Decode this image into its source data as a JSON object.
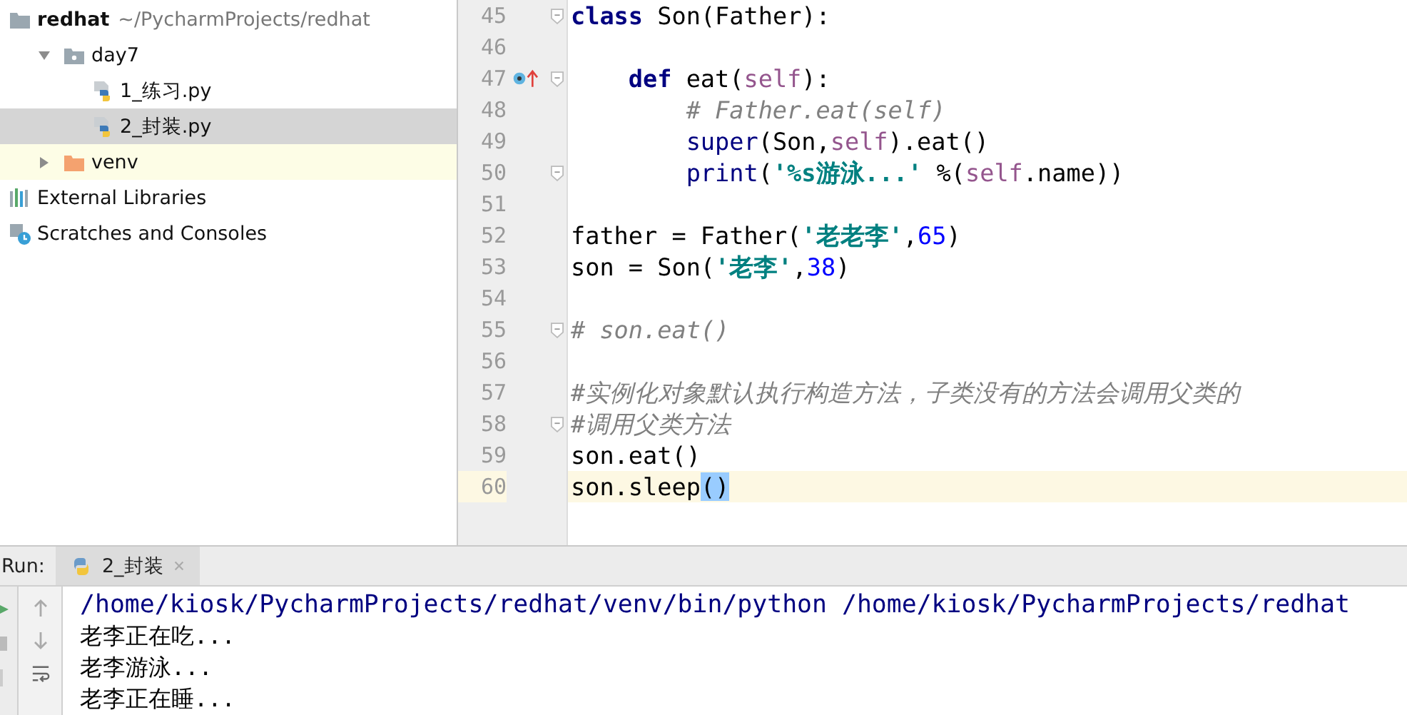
{
  "project_tree": {
    "items": [
      {
        "label": "redhat",
        "path": "~/PycharmProjects/redhat",
        "kind": "folder",
        "bold": true,
        "selected": false,
        "highlighted": false,
        "children": [
          {
            "label": "day7",
            "kind": "package",
            "expanded": true,
            "selected": false,
            "highlighted": false,
            "children": [
              {
                "label": "1_练习.py",
                "kind": "pyfile",
                "selected": false,
                "highlighted": false
              },
              {
                "label": "2_封装.py",
                "kind": "pyfile",
                "selected": true,
                "highlighted": false
              }
            ]
          },
          {
            "label": "venv",
            "kind": "venv",
            "expanded": false,
            "selected": false,
            "highlighted": true
          }
        ]
      },
      {
        "label": "External Libraries",
        "kind": "libraries",
        "selected": false,
        "highlighted": false
      },
      {
        "label": "Scratches and Consoles",
        "kind": "scratches",
        "selected": false,
        "highlighted": false
      }
    ]
  },
  "editor": {
    "lines": [
      {
        "number": "45",
        "fold": true,
        "current": false,
        "segments": [
          {
            "kind": "keyword",
            "text": "class"
          },
          {
            "kind": "plain",
            "text": " Son(Father):"
          }
        ],
        "children": [
          {
            "number": "46",
            "current": false
          },
          {
            "number": "47",
            "fold": true,
            "override": true,
            "current": false,
            "segments": [
              {
                "kind": "keyword",
                "text": "def"
              },
              {
                "kind": "plain",
                "text": " eat("
              },
              {
                "kind": "self",
                "text": "self"
              },
              {
                "kind": "plain",
                "text": "):"
              }
            ],
            "children": [
              {
                "number": "48",
                "current": false,
                "segments": [
                  {
                    "kind": "comment",
                    "text": "# Father.eat(self)"
                  }
                ]
              },
              {
                "number": "49",
                "current": false,
                "segments": [
                  {
                    "kind": "builtin",
                    "text": "super"
                  },
                  {
                    "kind": "plain",
                    "text": "(Son,"
                  },
                  {
                    "kind": "self",
                    "text": "self"
                  },
                  {
                    "kind": "plain",
                    "text": ").eat()"
                  }
                ]
              },
              {
                "number": "50",
                "fold": true,
                "current": false,
                "segments": [
                  {
                    "kind": "builtin",
                    "text": "print"
                  },
                  {
                    "kind": "plain",
                    "text": "("
                  },
                  {
                    "kind": "string",
                    "text": "'%s游泳...'"
                  },
                  {
                    "kind": "plain",
                    "text": " %("
                  },
                  {
                    "kind": "self",
                    "text": "self"
                  },
                  {
                    "kind": "plain",
                    "text": ".name))"
                  }
                ]
              }
            ]
          }
        ]
      },
      {
        "number": "51",
        "current": false
      },
      {
        "number": "52",
        "current": false,
        "segments": [
          {
            "kind": "plain",
            "text": "father = Father("
          },
          {
            "kind": "string",
            "text": "'老老李'"
          },
          {
            "kind": "plain",
            "text": ","
          },
          {
            "kind": "number",
            "text": "65"
          },
          {
            "kind": "plain",
            "text": ")"
          }
        ]
      },
      {
        "number": "53",
        "current": false,
        "segments": [
          {
            "kind": "plain",
            "text": "son = Son("
          },
          {
            "kind": "string",
            "text": "'老李'"
          },
          {
            "kind": "plain",
            "text": ","
          },
          {
            "kind": "number",
            "text": "38"
          },
          {
            "kind": "plain",
            "text": ")"
          }
        ]
      },
      {
        "number": "54",
        "current": false
      },
      {
        "number": "55",
        "fold": true,
        "current": false,
        "segments": [
          {
            "kind": "comment",
            "text": "# son.eat()"
          }
        ]
      },
      {
        "number": "56",
        "current": false
      },
      {
        "number": "57",
        "current": false,
        "segments": [
          {
            "kind": "comment",
            "text": "#实例化对象默认执行构造方法，子类没有的方法会调用父类的"
          }
        ]
      },
      {
        "number": "58",
        "fold": true,
        "current": false,
        "segments": [
          {
            "kind": "comment",
            "text": "#调用父类方法"
          }
        ]
      },
      {
        "number": "59",
        "current": false,
        "segments": [
          {
            "kind": "plain",
            "text": "son.eat()"
          }
        ]
      },
      {
        "number": "60",
        "current": true,
        "segments": [
          {
            "kind": "plain",
            "text": "son.sleep"
          },
          {
            "kind": "match",
            "text": "()"
          }
        ]
      }
    ]
  },
  "run_panel": {
    "label": "Run:",
    "tabs": [
      {
        "label": "2_封装",
        "selected": true
      }
    ],
    "output": [
      {
        "kind": "command",
        "text": "/home/kiosk/PycharmProjects/redhat/venv/bin/python /home/kiosk/PycharmProjects/redhat"
      },
      {
        "kind": "stdout",
        "text": "老李正在吃..."
      },
      {
        "kind": "stdout",
        "text": "老李游泳..."
      },
      {
        "kind": "stdout",
        "text": "老李正在睡..."
      }
    ]
  }
}
